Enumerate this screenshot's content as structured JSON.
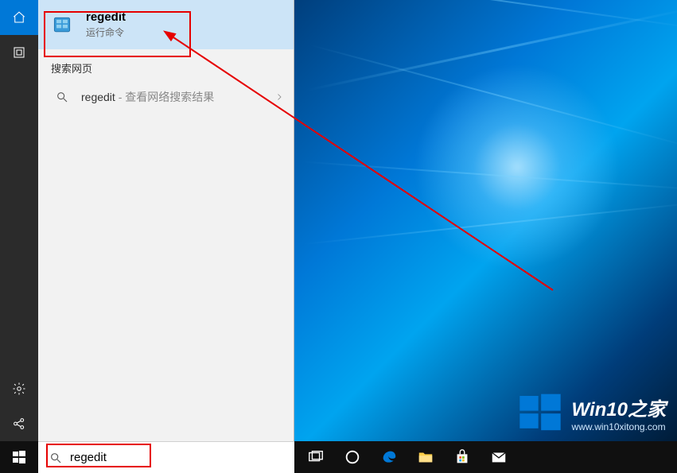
{
  "search": {
    "query": "regedit",
    "placeholder": ""
  },
  "best_match": {
    "title": "regedit",
    "subtitle": "运行命令"
  },
  "sections": {
    "web_header": "搜索网页"
  },
  "web_results": [
    {
      "term": "regedit",
      "hint": " - 查看网络搜索结果"
    }
  ],
  "watermark": {
    "title": "Win10之家",
    "url": "www.win10xitong.com"
  },
  "sidebar": {
    "top": [
      {
        "name": "home-icon",
        "active": true
      },
      {
        "name": "apps-icon",
        "active": false
      }
    ],
    "bottom": [
      {
        "name": "settings-icon"
      },
      {
        "name": "share-icon"
      }
    ]
  },
  "taskbar": {
    "icons": [
      {
        "name": "task-view-icon"
      },
      {
        "name": "cortana-icon"
      },
      {
        "name": "edge-icon"
      },
      {
        "name": "file-explorer-icon"
      },
      {
        "name": "store-icon"
      },
      {
        "name": "mail-icon"
      }
    ]
  },
  "colors": {
    "accent": "#0078d7",
    "selection": "#cce4f7",
    "annotation": "#e60000"
  }
}
